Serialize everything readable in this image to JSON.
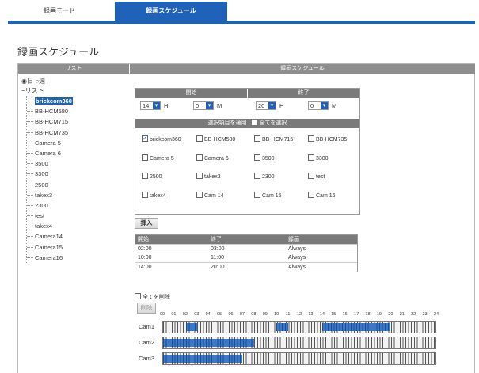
{
  "tabs": [
    {
      "label": "録画モード"
    },
    {
      "label": "録画スケジュール"
    }
  ],
  "page": {
    "title": "録画スケジュール"
  },
  "list_panel": {
    "header": "リスト",
    "radio_day": "◉日",
    "radio_week": "○週",
    "root": "リスト",
    "items": [
      "brickcom360",
      "BB-HCM580",
      "BB-HCM715",
      "BB-HCM735",
      "Camera 5",
      "Camera 6",
      "3500",
      "3300",
      "2500",
      "takex3",
      "2300",
      "test",
      "takex4",
      "Camera14",
      "Camera15",
      "Camera16"
    ],
    "selected": "brickcom360"
  },
  "schedule_panel": {
    "header": "録画スケジュール",
    "start_label": "開始",
    "end_label": "終了",
    "start_hour": "14",
    "start_min": "0",
    "end_hour": "20",
    "end_min": "0",
    "unit_h": "H",
    "unit_m": "M",
    "apply_label": "選択項目を適用",
    "select_all_label": "全てを選択",
    "cameras": [
      {
        "name": "brickcom360",
        "checked": true
      },
      {
        "name": "BB-HCM580",
        "checked": false
      },
      {
        "name": "BB-HCM715",
        "checked": false
      },
      {
        "name": "BB-HCM735",
        "checked": false
      },
      {
        "name": "Camera 5",
        "checked": false
      },
      {
        "name": "Camera 6",
        "checked": false
      },
      {
        "name": "3500",
        "checked": false
      },
      {
        "name": "3300",
        "checked": false
      },
      {
        "name": "2500",
        "checked": false
      },
      {
        "name": "takex3",
        "checked": false
      },
      {
        "name": "2300",
        "checked": false
      },
      {
        "name": "test",
        "checked": false
      },
      {
        "name": "takex4",
        "checked": false
      },
      {
        "name": "Cam 14",
        "checked": false
      },
      {
        "name": "Cam 15",
        "checked": false
      },
      {
        "name": "Cam 16",
        "checked": false
      }
    ],
    "insert_label": "挿入",
    "table": {
      "columns": [
        "開始",
        "終了",
        "録画"
      ],
      "rows": [
        [
          "02:00",
          "03:00",
          "Always"
        ],
        [
          "10:00",
          "11:00",
          "Always"
        ],
        [
          "14:00",
          "20:00",
          "Always"
        ]
      ]
    },
    "delete_all_label": "全てを削除",
    "delete_label": "削除"
  },
  "timeline": {
    "hours": [
      "00",
      "01",
      "02",
      "03",
      "04",
      "05",
      "06",
      "07",
      "08",
      "09",
      "10",
      "11",
      "12",
      "13",
      "14",
      "15",
      "16",
      "17",
      "18",
      "19",
      "20",
      "21",
      "22",
      "23",
      "24"
    ],
    "rows": [
      {
        "label": "Cam1",
        "ranges": [
          [
            2,
            3
          ],
          [
            10,
            11
          ],
          [
            14,
            20
          ]
        ]
      },
      {
        "label": "Cam2",
        "ranges": [
          [
            0,
            8
          ]
        ]
      },
      {
        "label": "Cam3",
        "ranges": [
          [
            0,
            7
          ]
        ]
      }
    ]
  }
}
